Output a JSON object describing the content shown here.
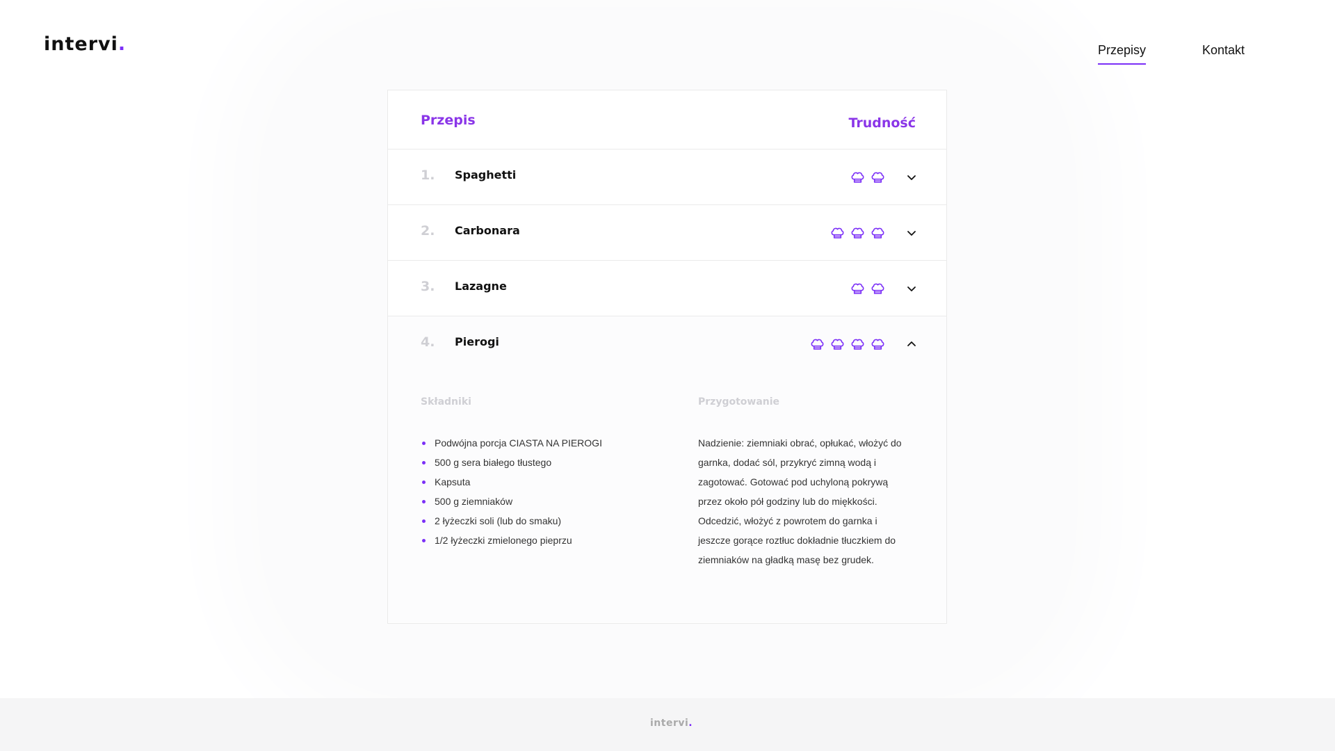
{
  "header": {
    "logo_text": "intervi",
    "logo_dot": ".",
    "nav": [
      {
        "label": "Przepisy",
        "active": true
      },
      {
        "label": "Kontakt",
        "active": false
      }
    ]
  },
  "table": {
    "col_recipe": "Przepis",
    "col_difficulty": "Trudność",
    "rows": [
      {
        "num": "1.",
        "name": "Spaghetti",
        "difficulty": 2,
        "expanded": false
      },
      {
        "num": "2.",
        "name": "Carbonara",
        "difficulty": 3,
        "expanded": false
      },
      {
        "num": "3.",
        "name": "Lazagne",
        "difficulty": 2,
        "expanded": false
      },
      {
        "num": "4.",
        "name": "Pierogi",
        "difficulty": 4,
        "expanded": true
      }
    ]
  },
  "details": {
    "ingredients_title": "Składniki",
    "preparation_title": "Przygotowanie",
    "ingredients": [
      "Podwójna porcja CIASTA NA PIEROGI",
      "500 g sera białego tłustego",
      "Kapsuta",
      "500 g ziemniaków",
      "2 łyżeczki soli (lub do smaku)",
      "1/2 łyżeczki zmielonego pieprzu"
    ],
    "preparation": "Nadzienie: ziemniaki obrać, opłukać, włożyć do garnka, dodać sól, przykryć zimną wodą i zagotować. Gotować pod uchyloną pokrywą przez około pół godziny lub do miękkości. Odcedzić, włożyć z powrotem do garnka i jeszcze gorące roztłuc dokładnie tłuczkiem do ziemniaków na gładką masę bez grudek."
  },
  "footer": {
    "logo_text": "intervi",
    "logo_dot": "."
  },
  "colors": {
    "accent": "#7b2ff7",
    "heading": "#8a35e8",
    "muted": "#cfcfd4"
  },
  "icons": {
    "difficulty": "chef-hat-icon",
    "collapsed": "chevron-down-icon",
    "expanded": "chevron-up-icon"
  }
}
